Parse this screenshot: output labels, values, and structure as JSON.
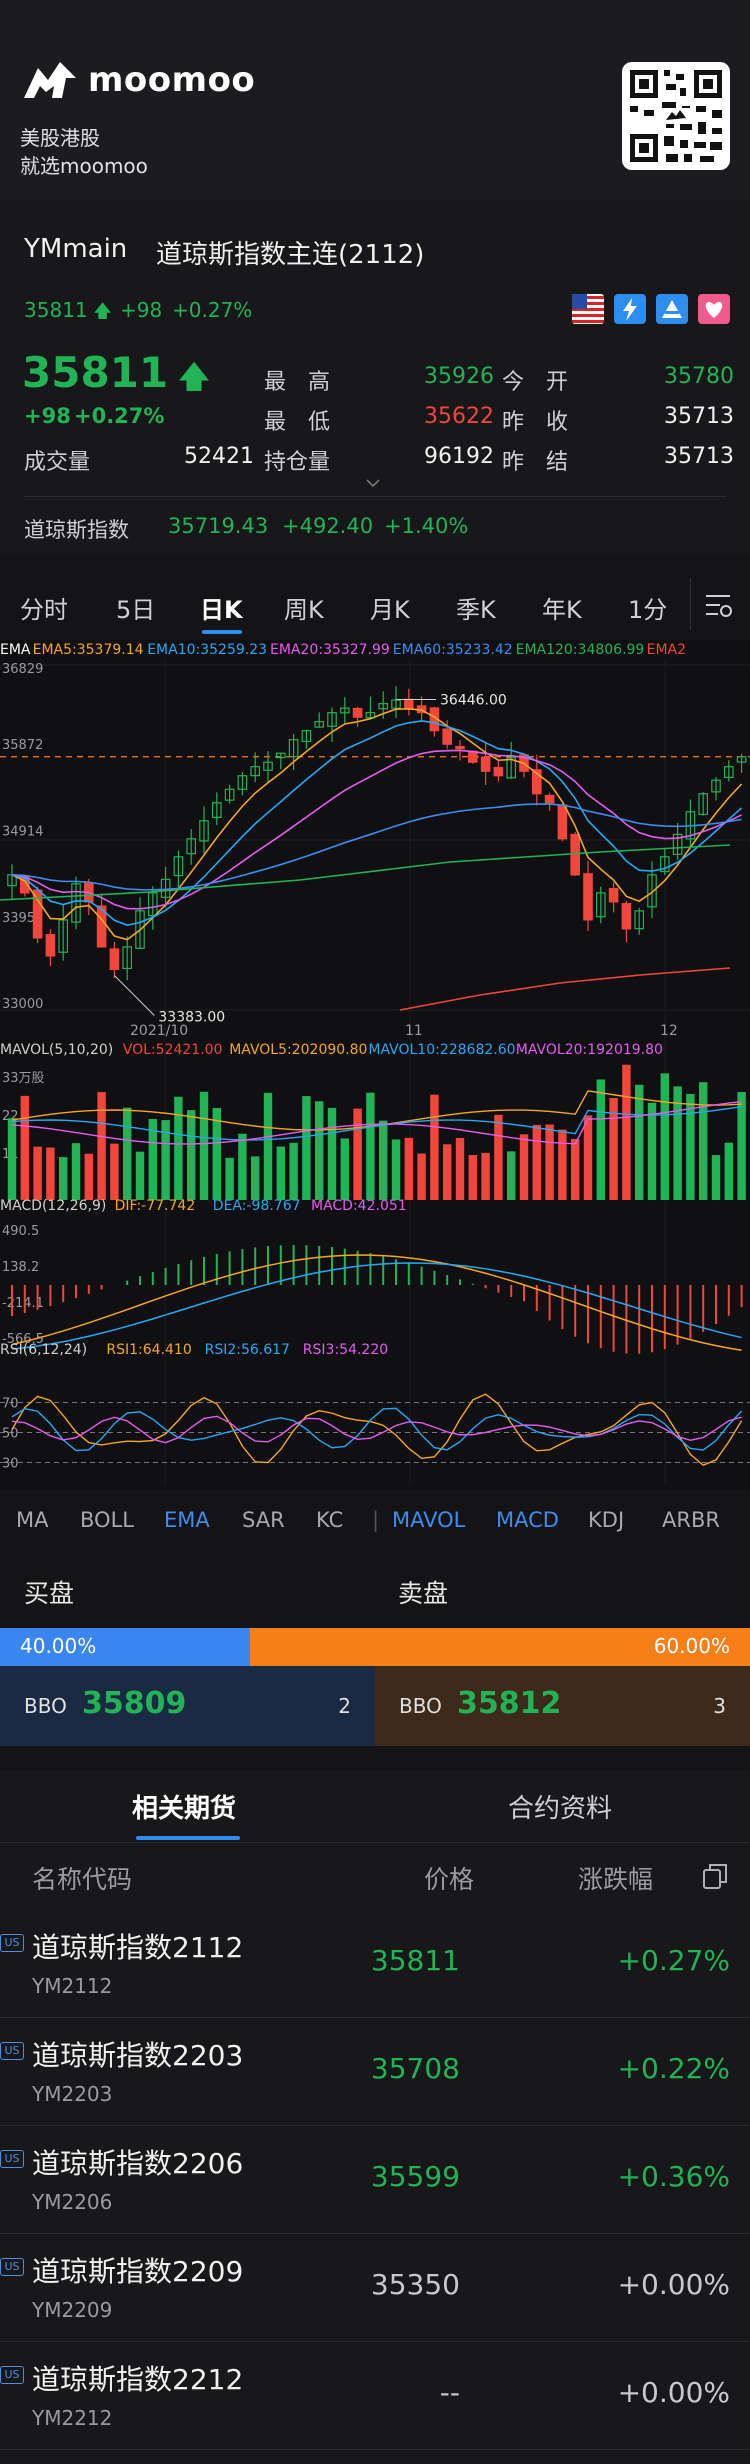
{
  "banner": {
    "brand": "moomoo",
    "tagline1": "美股港股",
    "tagline2": "就选moomoo"
  },
  "header": {
    "symbol": "YMmain",
    "title": "道琼斯指数主连(2112)",
    "mini_price": "35811",
    "mini_change": "+98",
    "mini_pct": "+0.27%"
  },
  "quote": {
    "price": "35811",
    "change": "+98",
    "pct": "+0.27%",
    "volume_label": "成交量",
    "volume": "52421",
    "high_label": "最　高",
    "high": "35926",
    "low_label": "最　低",
    "low": "35622",
    "oi_label": "持仓量",
    "oi": "96192",
    "open_label": "今　开",
    "open": "35780",
    "prevclose_label": "昨　收",
    "prevclose": "35713",
    "prevsettle_label": "昨　结",
    "prevsettle": "35713"
  },
  "index": {
    "name": "道琼斯指数",
    "value": "35719.43",
    "change": "+492.40",
    "pct": "+1.40%"
  },
  "tabs": [
    "分时",
    "5日",
    "日K",
    "周K",
    "月K",
    "季K",
    "年K",
    "1分"
  ],
  "active_tab": "日K",
  "chart": {
    "ema_legend": [
      "EMA",
      "EMA5:35379.14",
      "EMA10:35259.23",
      "EMA20:35327.99",
      "EMA60:35233.42",
      "EMA120:34806.99",
      "EMA2"
    ],
    "ema_colors": [
      "#ffffff",
      "#f5a623",
      "#27a8f5",
      "#e45cf0",
      "#3b8ef0",
      "#22b356",
      "#f0463c"
    ],
    "y_ticks": [
      "36829",
      "35872",
      "34914",
      "33957",
      "33000"
    ],
    "max_label": "36446.00",
    "min_label": "33383.00",
    "x_labels": [
      "2021/10",
      "11",
      "12"
    ],
    "vol_legend": [
      "MAVOL(5,10,20)",
      "VOL:52421.00",
      "MAVOL5:202090.80",
      "MAVOL10:228682.60",
      "MAVOL20:192019.80"
    ],
    "vol_colors": [
      "#d0d0d0",
      "#f0463c",
      "#f5a623",
      "#27a8f5",
      "#e45cf0"
    ],
    "vol_ticks": [
      "33万股",
      "22",
      "11"
    ],
    "macd_legend": [
      "MACD(12,26,9)",
      "DIF:-77.742",
      "DEA:-98.767",
      "MACD:42.051"
    ],
    "macd_colors": [
      "#d0d0d0",
      "#f5a623",
      "#27a8f5",
      "#e45cf0"
    ],
    "macd_ticks": [
      "490.5",
      "138.2",
      "-214.1",
      "-566.5"
    ],
    "rsi_legend": [
      "RSI(6,12,24)",
      "RSI1:64.410",
      "RSI2:56.617",
      "RSI3:54.220"
    ],
    "rsi_colors": [
      "#d0d0d0",
      "#f5a623",
      "#27a8f5",
      "#e45cf0"
    ],
    "rsi_ticks": [
      "70",
      "50",
      "30"
    ]
  },
  "indicators": [
    "MA",
    "BOLL",
    "EMA",
    "SAR",
    "KC",
    "|",
    "MAVOL",
    "MACD",
    "KDJ",
    "ARBR"
  ],
  "active_indicators": [
    "EMA",
    "MAVOL",
    "MACD"
  ],
  "bbo": {
    "buy_label": "买盘",
    "sell_label": "卖盘",
    "buy_pct": "40.00%",
    "sell_pct": "60.00%",
    "buy_fraction": 0.4,
    "bid_label": "BBO",
    "bid_price": "35809",
    "bid_size": "2",
    "ask_label": "BBO",
    "ask_price": "35812",
    "ask_size": "3"
  },
  "related": {
    "tabs": [
      "相关期货",
      "合约资料"
    ],
    "active_tab": "相关期货",
    "headers": [
      "名称代码",
      "价格",
      "涨跌幅"
    ],
    "rows": [
      {
        "badge": "US",
        "name": "道琼斯指数2112",
        "code": "YM2112",
        "price": "35811",
        "change": "+0.27%",
        "color": "#22b356"
      },
      {
        "badge": "US",
        "name": "道琼斯指数2203",
        "code": "YM2203",
        "price": "35708",
        "change": "+0.22%",
        "color": "#22b356"
      },
      {
        "badge": "US",
        "name": "道琼斯指数2206",
        "code": "YM2206",
        "price": "35599",
        "change": "+0.36%",
        "color": "#22b356"
      },
      {
        "badge": "US",
        "name": "道琼斯指数2209",
        "code": "YM2209",
        "price": "35350",
        "change": "+0.00%",
        "color": "#c8c8cc"
      },
      {
        "badge": "US",
        "name": "道琼斯指数2212",
        "code": "YM2212",
        "price": "--",
        "change": "+0.00%",
        "color": "#c8c8cc"
      }
    ]
  }
}
